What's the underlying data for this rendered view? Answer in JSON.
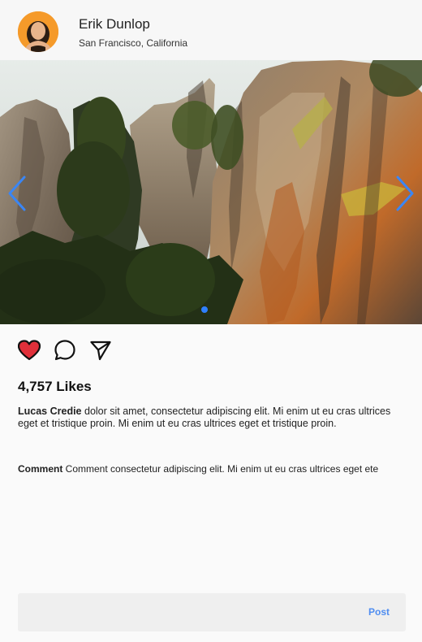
{
  "header": {
    "name": "Erik Dunlop",
    "location": "San Francisco, California",
    "avatar_icon": "user-avatar"
  },
  "carousel": {
    "total_slides": 1,
    "current_slide": 1,
    "prev_icon": "chevron-left-icon",
    "next_icon": "chevron-right-icon",
    "indicator_color": "#2f80ff"
  },
  "actions": {
    "like_icon": "heart-icon",
    "like_active": true,
    "like_color": "#e0303a",
    "comment_icon": "speech-bubble-icon",
    "share_icon": "paper-plane-icon"
  },
  "likes": {
    "text": "4,757 Likes"
  },
  "caption": {
    "user": "Lucas Credie",
    "text": " dolor sit amet, consectetur adipiscing elit. Mi enim ut eu cras ultrices eget et tristique proin. Mi enim ut eu cras ultrices eget et tristique proin."
  },
  "comment": {
    "user": "Comment",
    "text": " Comment consectetur adipiscing elit. Mi enim ut eu cras ultrices eget ete"
  },
  "comment_box": {
    "placeholder": "",
    "post_label": "Post",
    "post_color": "#4f8df0"
  }
}
